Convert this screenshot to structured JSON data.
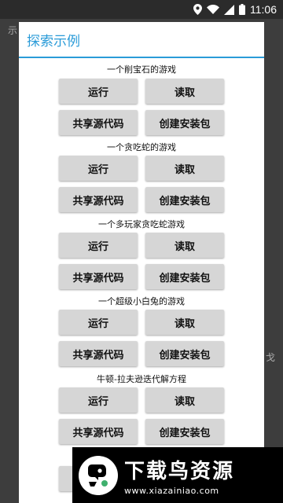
{
  "status_bar": {
    "time": "11:06",
    "icons": [
      "location-icon",
      "wifi-icon",
      "signal-icon",
      "battery-icon"
    ]
  },
  "background": {
    "left_text": "示",
    "right_text": "戈"
  },
  "dialog": {
    "title": "探索示例",
    "accent_color": "#2a9bd8",
    "sections": [
      {
        "heading": "一个削宝石的游戏",
        "run": "运行",
        "read": "读取",
        "share": "共享源代码",
        "build": "创建安装包"
      },
      {
        "heading": "一个贪吃蛇的游戏",
        "run": "运行",
        "read": "读取",
        "share": "共享源代码",
        "build": "创建安装包"
      },
      {
        "heading": "一个多玩家贪吃蛇游戏",
        "run": "运行",
        "read": "读取",
        "share": "共享源代码",
        "build": "创建安装包"
      },
      {
        "heading": "一个超级小白兔的游戏",
        "run": "运行",
        "read": "读取",
        "share": "共享源代码",
        "build": "创建安装包"
      },
      {
        "heading": "牛顿-拉夫逊迭代解方程",
        "run": "运行",
        "read": "读取",
        "share": "共享源代码",
        "build": "创建安装包"
      }
    ],
    "partial_button": "运行"
  },
  "watermark": {
    "title": "下载鸟资源",
    "url": "www.xiazainiao.com"
  }
}
